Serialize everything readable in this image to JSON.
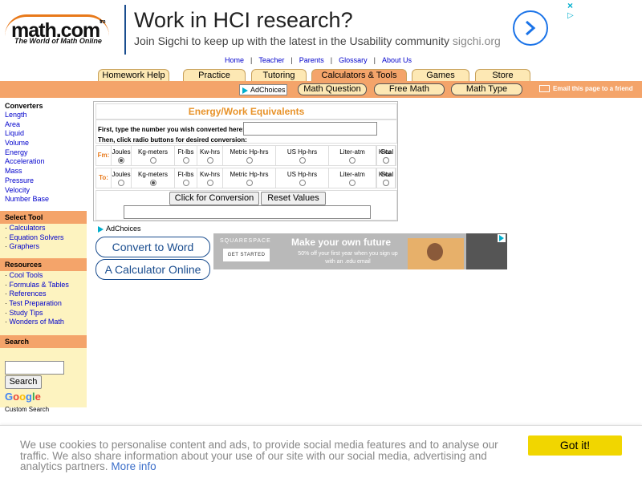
{
  "logo": {
    "brand": "math.com",
    "tm": "tm",
    "tagline": "The World of Math Online"
  },
  "top_ad": {
    "headline": "Work in HCI research?",
    "subline": "Join Sigchi to keep up with the latest in the Usability community",
    "domain": "sigchi.org",
    "close": "×",
    "info": "▷",
    "accent": "#1a73e8"
  },
  "toplinks": [
    "Home",
    "Teacher",
    "Parents",
    "Glossary",
    "About Us"
  ],
  "toplinks_sep": "|",
  "tabs": [
    {
      "label": "Homework Help",
      "active": false
    },
    {
      "label": "Practice",
      "active": false
    },
    {
      "label": "Tutoring",
      "active": false
    },
    {
      "label": "Calculators & Tools",
      "active": true
    },
    {
      "label": "Games",
      "active": false
    },
    {
      "label": "Store",
      "active": false
    }
  ],
  "subnav": {
    "adchoices": "AdChoices",
    "pills": [
      "Math Question",
      "Free Math",
      "Math Type"
    ],
    "email": "Email this page to a friend"
  },
  "sidebar": {
    "converters": {
      "title": "Converters",
      "items": [
        "Length",
        "Area",
        "Liquid",
        "Volume",
        "Energy",
        "Acceleration",
        "Mass",
        "Pressure",
        "Velocity",
        "Number Base"
      ]
    },
    "select_tool": {
      "title": "Select Tool",
      "items": [
        "Calculators",
        "Equation Solvers",
        "Graphers"
      ]
    },
    "resources": {
      "title": "Resources",
      "items": [
        "Cool Tools",
        "Formulas & Tables",
        "References",
        "Test Preparation",
        "Study Tips",
        "Wonders of Math"
      ]
    },
    "search": {
      "title": "Search",
      "button": "Search",
      "input_value": "",
      "google": "Google",
      "custom": "Custom Search"
    },
    "bullet": "·"
  },
  "converter": {
    "title": "Energy/Work Equivalents",
    "instr1": "First, type the number you wish converted here:",
    "instr2": "Then, click radio buttons for desired conversion:",
    "input_value": "",
    "from_label": "Fm:",
    "to_label": "To:",
    "units": [
      "Joules",
      "Kg-meters",
      "Ft-lbs",
      "Kw-hrs",
      "Metric Hp-hrs",
      "US Hp-hrs",
      "Liter-atm",
      "K-cal",
      "Btu"
    ],
    "from_selected": "Joules",
    "to_selected": "Kg-meters",
    "convert_button": "Click for Conversion",
    "reset_button": "Reset Values",
    "result_value": "",
    "title_color": "#e8932a"
  },
  "ads_below": {
    "adchoices": "AdChoices",
    "pills": [
      "Convert to Word",
      "A Calculator Online"
    ],
    "squarespace": {
      "brand": "SQUARESPACE",
      "cta": "GET STARTED",
      "headline": "Make your own future",
      "subline": "50% off your first year when you sign up with an .edu email"
    }
  },
  "cookie": {
    "text": "We use cookies to personalise content and ads, to provide social media features and to analyse our traffic. We also share information about your use of our site with our social media, advertising and analytics partners.",
    "more": "More info",
    "button": "Got it!",
    "button_color": "#f1d600"
  },
  "colors": {
    "orange": "#f4a46a",
    "tab": "#fde8b4",
    "link": "#0000cc",
    "sidebar_bg": "#fdf3c0"
  }
}
